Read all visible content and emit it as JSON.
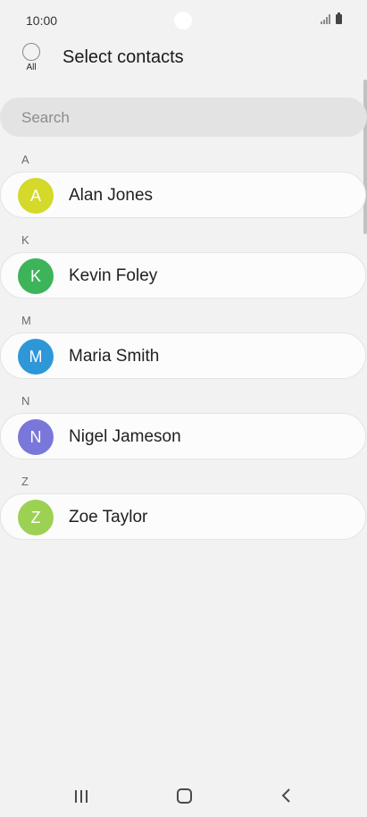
{
  "status_bar": {
    "time": "10:00"
  },
  "header": {
    "select_all_label": "All",
    "title": "Select contacts"
  },
  "search": {
    "placeholder": "Search"
  },
  "sections": [
    {
      "letter": "A",
      "contact": {
        "name": "Alan Jones",
        "initial": "A",
        "color": "#d4d92a"
      }
    },
    {
      "letter": "K",
      "contact": {
        "name": "Kevin Foley",
        "initial": "K",
        "color": "#3db35a"
      }
    },
    {
      "letter": "M",
      "contact": {
        "name": "Maria Smith",
        "initial": "M",
        "color": "#2e97d8"
      }
    },
    {
      "letter": "N",
      "contact": {
        "name": "Nigel Jameson",
        "initial": "N",
        "color": "#7a77db"
      }
    },
    {
      "letter": "Z",
      "contact": {
        "name": "Zoe Taylor",
        "initial": "Z",
        "color": "#9dd153"
      }
    }
  ],
  "nav": {
    "icons": [
      "recent-apps-icon",
      "home-icon",
      "back-icon"
    ]
  }
}
